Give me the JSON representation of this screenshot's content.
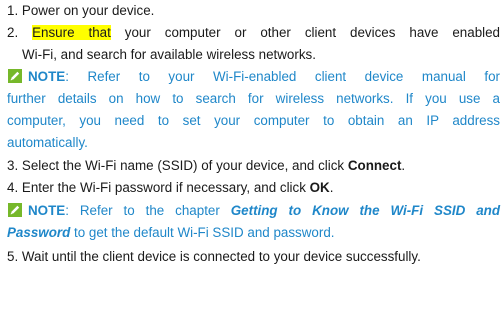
{
  "steps": {
    "s1": "1. Power on your device.",
    "s2_num": "2. ",
    "s2_highlight": "Ensure that",
    "s2_rest_a": " your computer or other client devices have enabled",
    "s2_rest_b": "Wi-Fi, and search for available wireless networks.",
    "s3_a": "3. Select the Wi-Fi name (SSID) of your device, and click ",
    "s3_bold": "Connect",
    "s3_end": ".",
    "s4_a": "4. Enter the Wi-Fi password if necessary, and click ",
    "s4_bold": "OK",
    "s4_end": ".",
    "s5": "5. Wait until the client device is connected to your device successfully."
  },
  "note1": {
    "label": "NOTE",
    "line1": ": Refer to your Wi-Fi-enabled client device manual for",
    "line2": "further details on how to search for wireless networks.   If you use a",
    "line3": "computer, you need to set your computer to obtain an IP address",
    "line4": "automatically."
  },
  "note2": {
    "label": "NOTE",
    "line1_a": ": Refer to the chapter ",
    "line1_bi": "Getting to Know the Wi-Fi SSID and",
    "line2_bi": "Password",
    "line2_rest": " to get the default Wi-Fi SSID and password."
  },
  "colors": {
    "note_text": "#1f87c9",
    "note_icon_bg": "#76b82a",
    "highlight": "#ffff00"
  },
  "icons": {
    "note_icon": "pencil-note-icon"
  }
}
